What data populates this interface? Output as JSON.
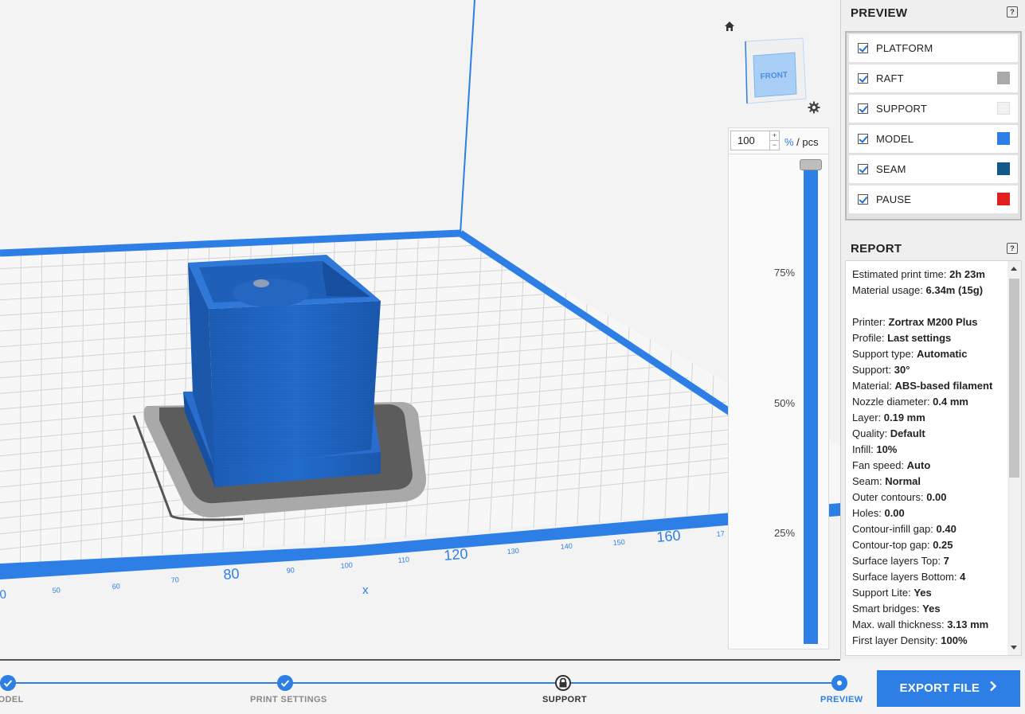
{
  "preview": {
    "title": "PREVIEW",
    "help": "?",
    "layers": [
      {
        "label": "PLATFORM",
        "checked": true,
        "color": null
      },
      {
        "label": "RAFT",
        "checked": true,
        "color": "#aaaaaa"
      },
      {
        "label": "SUPPORT",
        "checked": true,
        "color": "#f2f2f2"
      },
      {
        "label": "MODEL",
        "checked": true,
        "color": "#2d7fe6"
      },
      {
        "label": "SEAM",
        "checked": true,
        "color": "#0f5a8a"
      },
      {
        "label": "PAUSE",
        "checked": true,
        "color": "#e02020"
      }
    ]
  },
  "report": {
    "title": "REPORT",
    "help": "?",
    "lines": [
      {
        "key": "Estimated print time: ",
        "value": "2h 23m"
      },
      {
        "key": "Material usage: ",
        "value": "6.34m (15g)"
      },
      {
        "key": "",
        "value": ""
      },
      {
        "key": "Printer: ",
        "value": "Zortrax M200 Plus"
      },
      {
        "key": "Profile: ",
        "value": "Last settings"
      },
      {
        "key": "Support type: ",
        "value": "Automatic"
      },
      {
        "key": "Support: ",
        "value": "30°"
      },
      {
        "key": "Material: ",
        "value": "ABS-based filament"
      },
      {
        "key": "Nozzle diameter: ",
        "value": "0.4 mm"
      },
      {
        "key": "Layer: ",
        "value": "0.19 mm"
      },
      {
        "key": "Quality: ",
        "value": "Default"
      },
      {
        "key": "Infill: ",
        "value": "10%"
      },
      {
        "key": "Fan speed: ",
        "value": "Auto"
      },
      {
        "key": "Seam: ",
        "value": "Normal"
      },
      {
        "key": "Outer contours: ",
        "value": "0.00"
      },
      {
        "key": "Holes: ",
        "value": "0.00"
      },
      {
        "key": "Contour-infill gap: ",
        "value": "0.40"
      },
      {
        "key": "Contour-top gap: ",
        "value": "0.25"
      },
      {
        "key": "Surface layers Top: ",
        "value": "7"
      },
      {
        "key": "Surface layers Bottom: ",
        "value": "4"
      },
      {
        "key": "Support Lite: ",
        "value": "Yes"
      },
      {
        "key": "Smart bridges: ",
        "value": "Yes"
      },
      {
        "key": "Max. wall thickness: ",
        "value": "3.13 mm"
      },
      {
        "key": "First layer Density: ",
        "value": "100%"
      }
    ]
  },
  "slider": {
    "value": "100",
    "unit_pct": "%",
    "unit_rest": " / pcs",
    "ticks": [
      "75%",
      "50%",
      "25%"
    ]
  },
  "viewcube": {
    "face_label": "FRONT"
  },
  "axis": {
    "labels": [
      "0",
      "50",
      "60",
      "70",
      "80",
      "90",
      "100",
      "110",
      "120",
      "130",
      "140",
      "150",
      "160",
      "17"
    ],
    "axis_name": "x"
  },
  "workflow": {
    "steps": [
      {
        "label": "MODEL",
        "state": "done"
      },
      {
        "label": "PRINT SETTINGS",
        "state": "done"
      },
      {
        "label": "SUPPORT",
        "state": "locked"
      },
      {
        "label": "PREVIEW",
        "state": "current"
      }
    ],
    "export_label": "EXPORT FILE"
  },
  "colors": {
    "accent": "#2d7fe6",
    "model": "#1f64c2"
  }
}
